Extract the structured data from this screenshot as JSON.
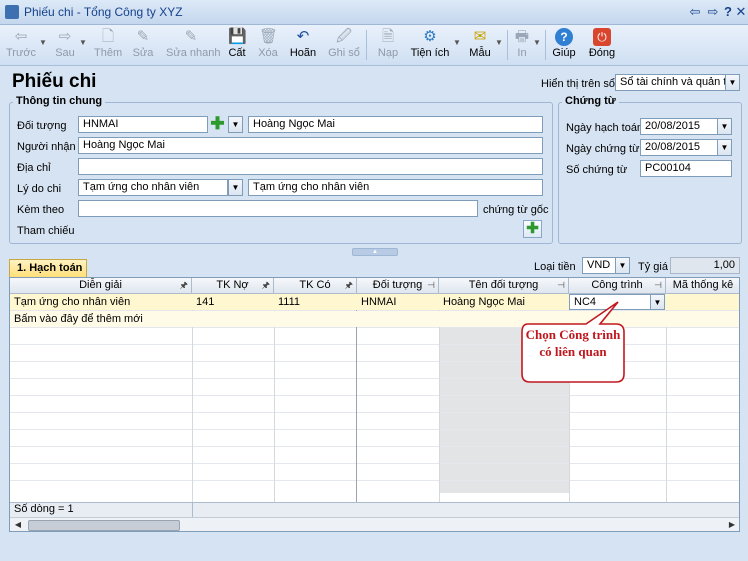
{
  "window": {
    "title": "Phiếu chi - Tổng Công ty XYZ",
    "controls": [
      "⇦",
      "⇨",
      "?",
      "✕"
    ]
  },
  "toolbar": {
    "back": "Trước",
    "next": "Sau",
    "add": "Thêm",
    "edit": "Sửa",
    "quick_edit": "Sửa nhanh",
    "save": "Cất",
    "delete": "Xóa",
    "undo": "Hoãn",
    "post": "Ghi sổ",
    "load": "Nạp",
    "utilities": "Tiện ích",
    "template": "Mẫu",
    "print": "In",
    "help": "Giúp",
    "close": "Đóng"
  },
  "header": {
    "title": "Phiếu chi",
    "display_label": "Hiển thị trên sổ",
    "display_value": "Sổ tài chính và quản trị"
  },
  "general": {
    "group_title": "Thông tin chung",
    "object_label": "Đối tượng",
    "object_code": "HNMAI",
    "object_name": "Hoàng Ngọc Mai",
    "receiver_label": "Người nhận",
    "receiver_value": "Hoàng Ngọc Mai",
    "address_label": "Địa chỉ",
    "address_value": "",
    "reason_label": "Lý do chi",
    "reason_select": "Tạm ứng cho nhân viên",
    "reason_text": "Tạm ứng cho nhân viên",
    "attach_label": "Kèm theo",
    "attach_value": "",
    "attach_suffix": "chứng từ gốc",
    "reference_label": "Tham chiếu"
  },
  "voucher": {
    "group_title": "Chứng từ",
    "posting_date_label": "Ngày hạch toán",
    "posting_date": "20/08/2015",
    "voucher_date_label": "Ngày chứng từ",
    "voucher_date": "20/08/2015",
    "voucher_no_label": "Số chứng từ",
    "voucher_no": "PC00104"
  },
  "currency": {
    "label": "Loại tiền",
    "value": "VND",
    "rate_label": "Tỷ giá",
    "rate_value": "1,00"
  },
  "tab": {
    "label": "1. Hạch toán"
  },
  "grid": {
    "columns": [
      "Diễn giải",
      "TK Nợ",
      "TK Có",
      "Đối tượng",
      "Tên đối tượng",
      "Công trình",
      "Mã thống kê"
    ],
    "rows": [
      {
        "desc": "Tạm ứng cho nhân viên",
        "debit": "141",
        "credit": "1111",
        "object": "HNMAI",
        "object_name": "Hoàng Ngọc Mai",
        "project": "NC4",
        "stat": ""
      }
    ],
    "add_row_hint": "Bấm vào đây để thêm mới",
    "footer": "Số dòng = 1"
  },
  "annotation": {
    "text": "Chọn Công trình có liên quan",
    "color": "#c0181e"
  }
}
